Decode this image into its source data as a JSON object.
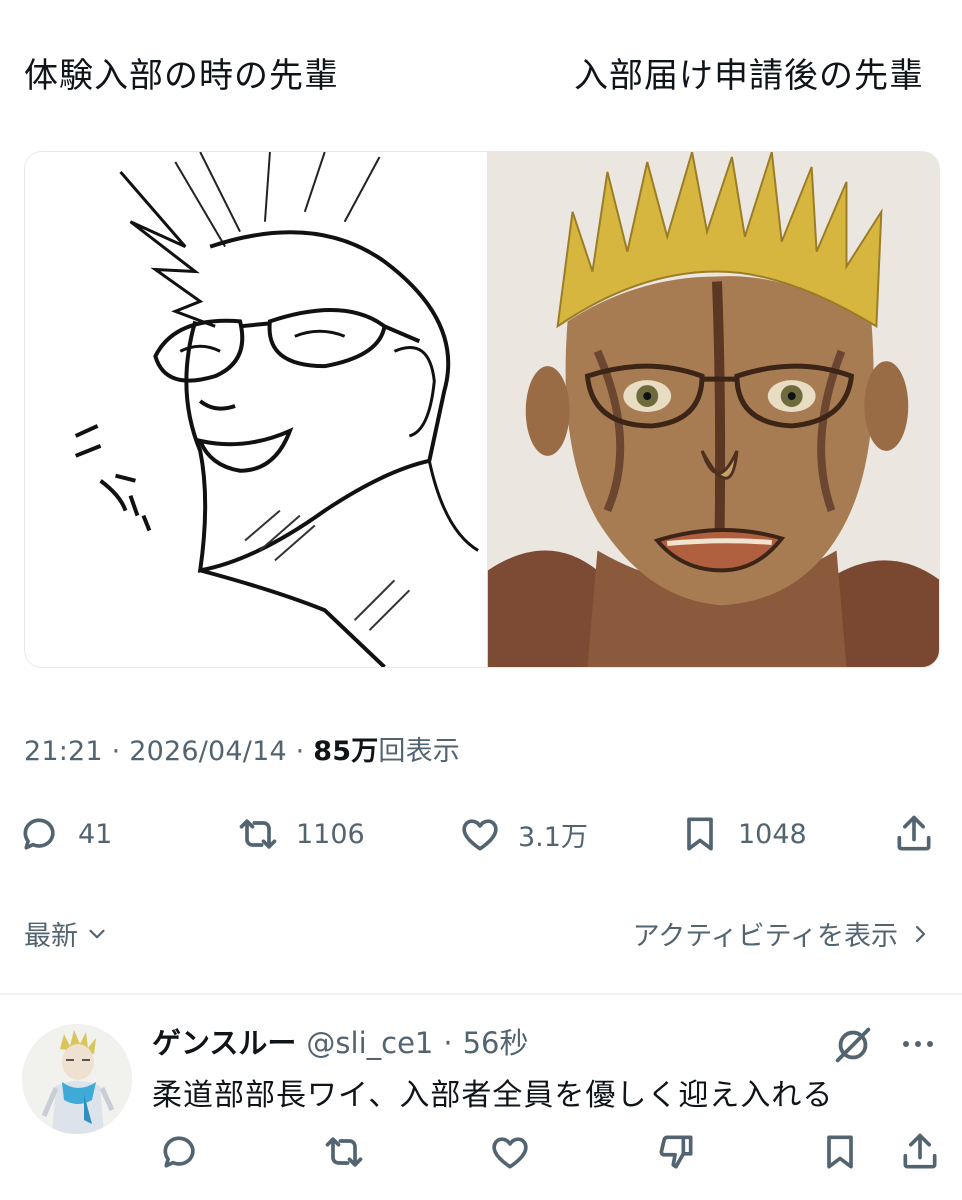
{
  "post": {
    "caption_left": "体験入部の時の先輩",
    "caption_right": "入部届け申請後の先輩",
    "time": "21:21",
    "date": "2026/04/14",
    "views_count": "85万",
    "views_label": "回表示",
    "separator": "·"
  },
  "actions": {
    "reply": {
      "icon": "reply-icon",
      "count": "41"
    },
    "repost": {
      "icon": "repost-icon",
      "count": "1106"
    },
    "like": {
      "icon": "heart-icon",
      "count": "3.1万"
    },
    "bookmark": {
      "icon": "bookmark-icon",
      "count": "1048"
    },
    "share": {
      "icon": "share-icon"
    }
  },
  "replies_header": {
    "sort_label": "最新",
    "activity_label": "アクティビティを表示"
  },
  "reply": {
    "name": "ゲンスルー",
    "handle": "@sli_ce1",
    "separator": "·",
    "time": "56秒",
    "text": "柔道部部長ワイ、入部者全員を優しく迎え入れる"
  },
  "colors": {
    "text_primary": "#0f1419",
    "text_secondary": "#536471",
    "divider": "#eff3f4"
  }
}
